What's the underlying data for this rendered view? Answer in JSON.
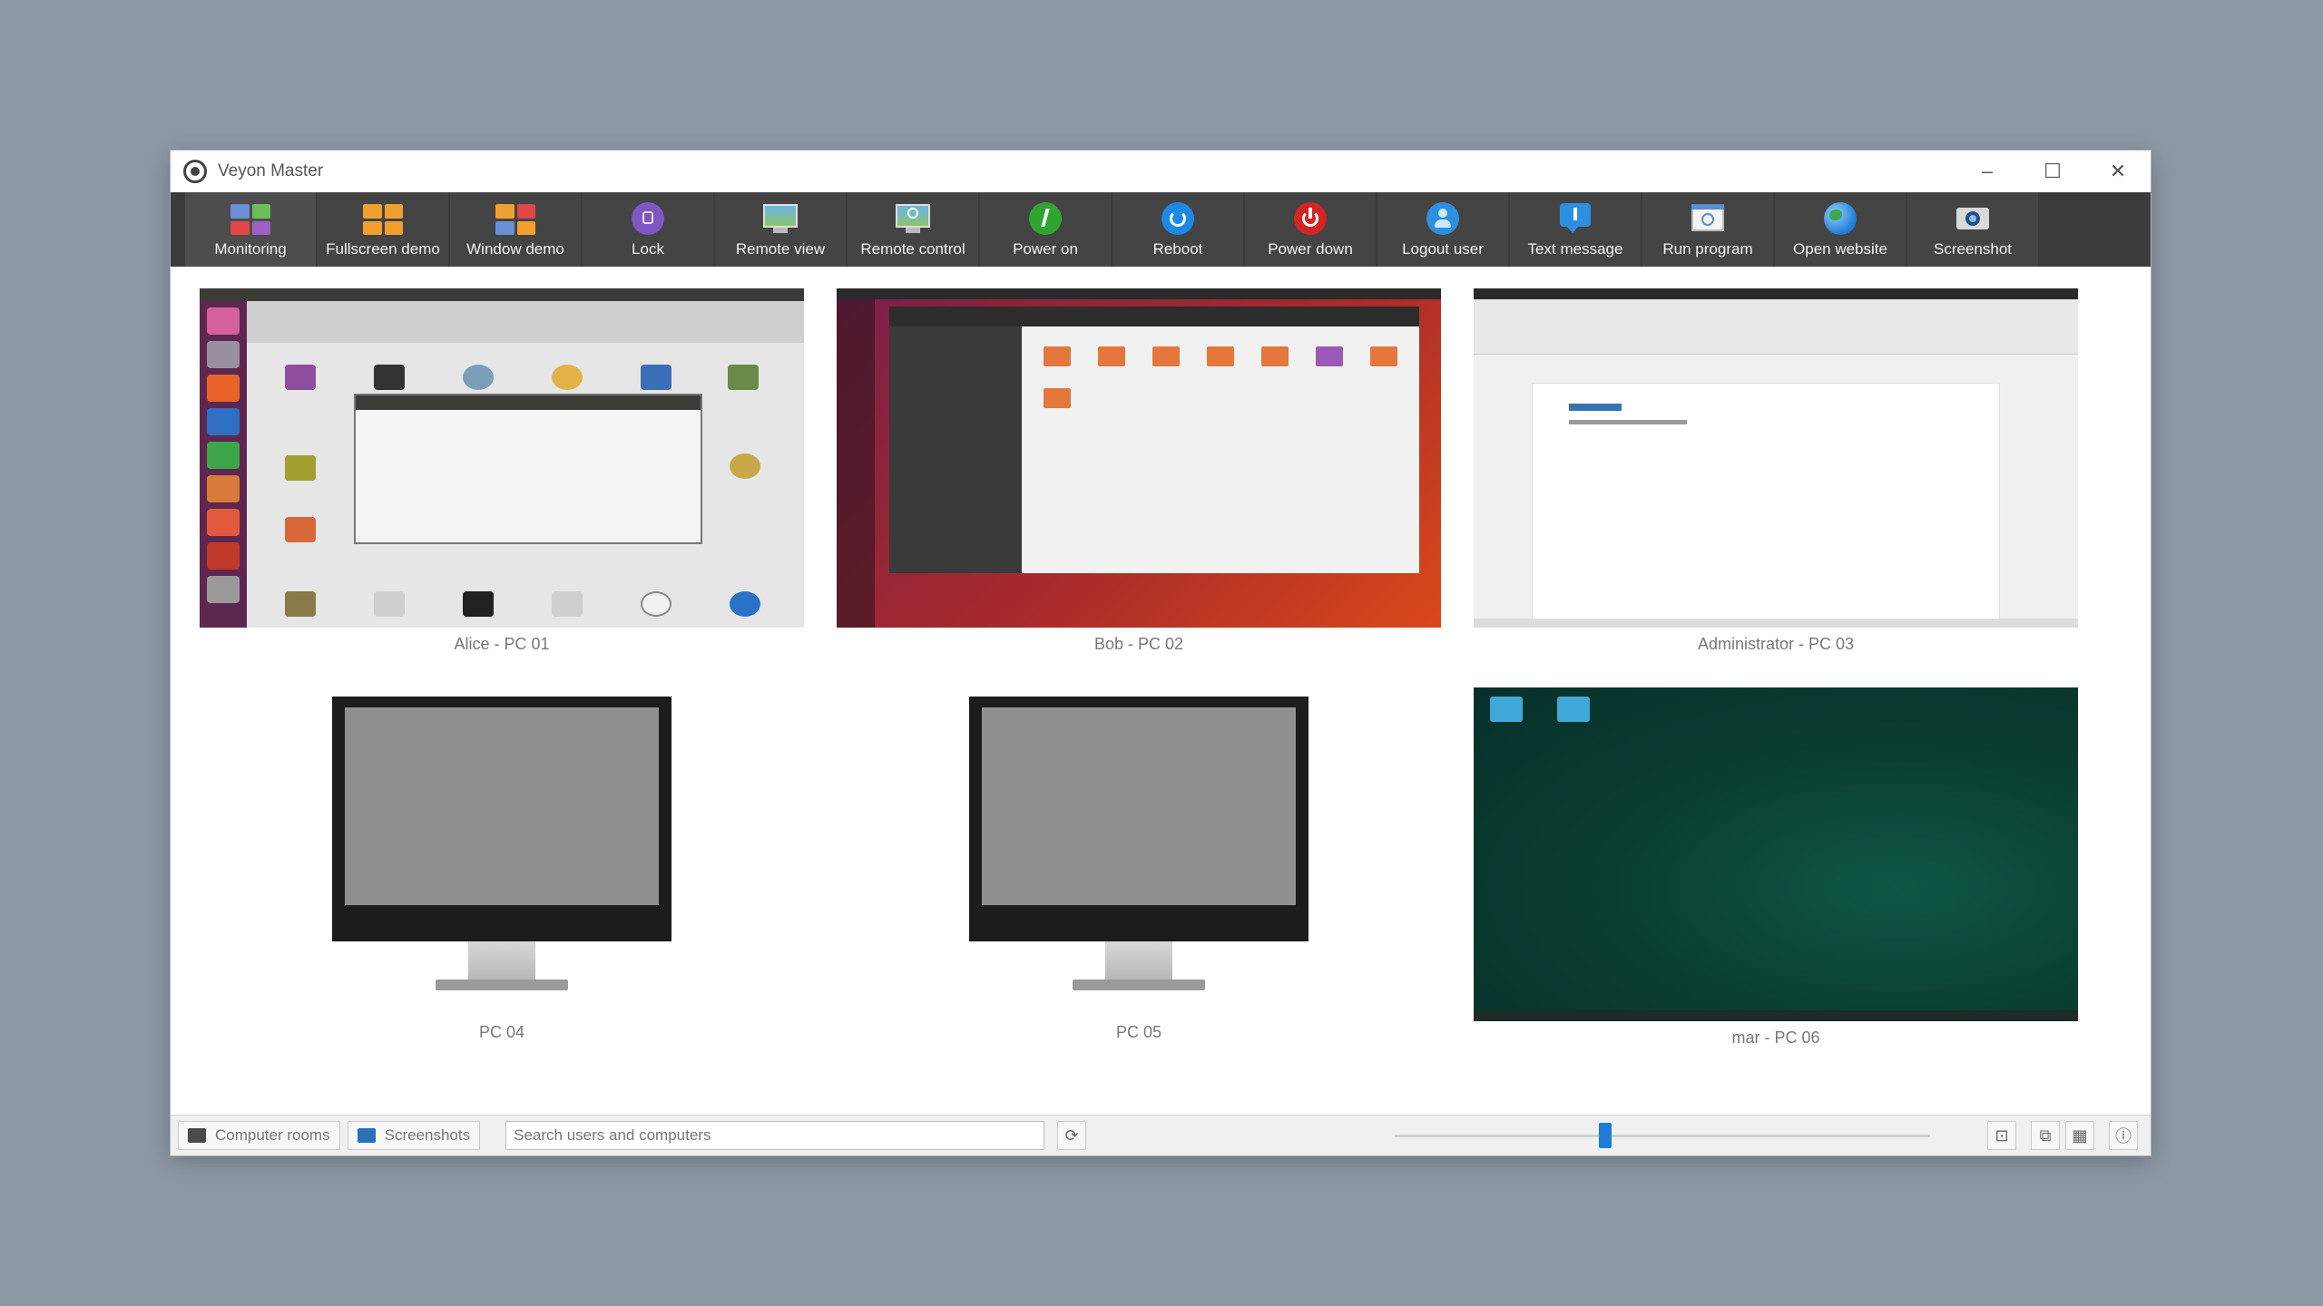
{
  "window": {
    "title": "Veyon Master",
    "controls": {
      "minimize": "–",
      "maximize": "☐",
      "close": "✕"
    }
  },
  "toolbar": {
    "buttons": [
      {
        "label": "Monitoring",
        "icon": "monitoring-icon"
      },
      {
        "label": "Fullscreen demo",
        "icon": "fullscreen-demo-icon"
      },
      {
        "label": "Window demo",
        "icon": "window-demo-icon"
      },
      {
        "label": "Lock",
        "icon": "lock-icon"
      },
      {
        "label": "Remote view",
        "icon": "remote-view-icon"
      },
      {
        "label": "Remote control",
        "icon": "remote-control-icon"
      },
      {
        "label": "Power on",
        "icon": "power-on-icon"
      },
      {
        "label": "Reboot",
        "icon": "reboot-icon"
      },
      {
        "label": "Power down",
        "icon": "power-down-icon"
      },
      {
        "label": "Logout user",
        "icon": "logout-user-icon"
      },
      {
        "label": "Text message",
        "icon": "text-message-icon"
      },
      {
        "label": "Run program",
        "icon": "run-program-icon"
      },
      {
        "label": "Open website",
        "icon": "open-website-icon"
      },
      {
        "label": "Screenshot",
        "icon": "screenshot-icon"
      }
    ]
  },
  "computers": [
    {
      "label": "Alice - PC 01",
      "state": "ubuntu-settings-desktop"
    },
    {
      "label": "Bob - PC 02",
      "state": "ubuntu-file-manager-desktop"
    },
    {
      "label": "Administrator - PC 03",
      "state": "libreoffice-writer-desktop"
    },
    {
      "label": "PC 04",
      "state": "offline-monitor"
    },
    {
      "label": "PC 05",
      "state": "offline-monitor"
    },
    {
      "label": "mar - PC 06",
      "state": "green-desktop"
    }
  ],
  "statusbar": {
    "computer_rooms_label": "Computer rooms",
    "screenshots_label": "Screenshots",
    "search_placeholder": "Search users and computers",
    "zoom_level": 0.39
  },
  "colors": {
    "toolbar_bg": "#3b3b3b",
    "accent": "#1e7bd6",
    "power_on": "#2fa52f",
    "power_down": "#d42424",
    "reboot": "#1e88e5",
    "lock": "#7e57c2"
  }
}
